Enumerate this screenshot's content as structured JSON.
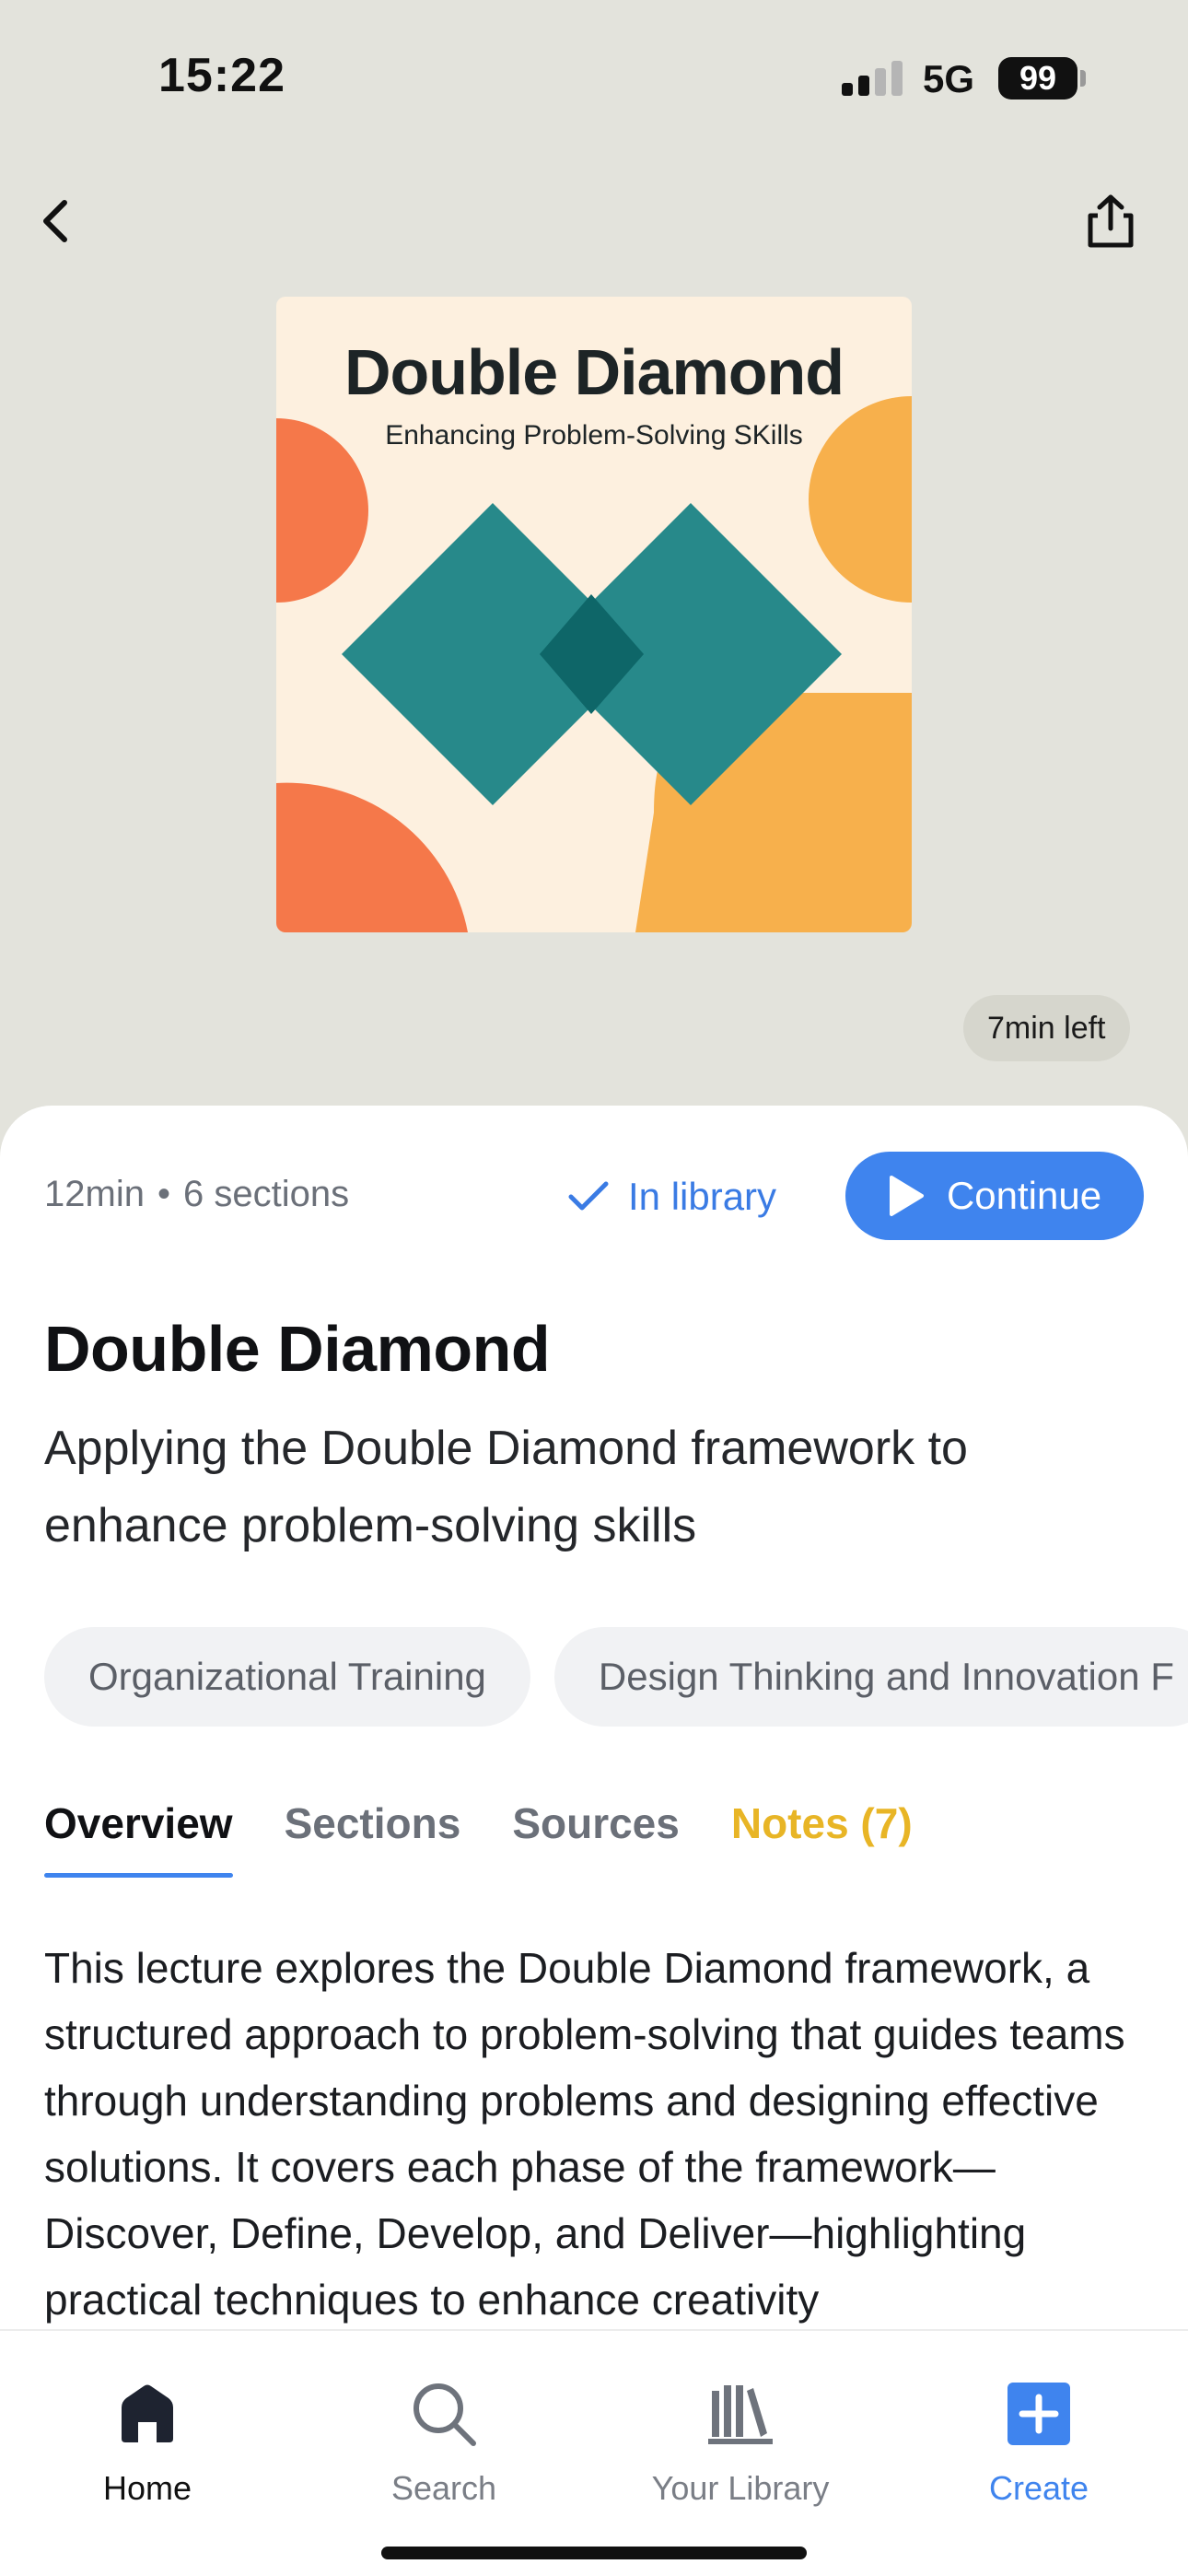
{
  "status_bar": {
    "time": "15:22",
    "network": "5G",
    "battery": "99"
  },
  "header": {
    "back_icon": "chevron-left-icon",
    "share_icon": "share-icon"
  },
  "cover": {
    "title": "Double Diamond",
    "subtitle": "Enhancing Problem-Solving SKills",
    "colors": {
      "background": "#fdf0df",
      "teal": "#27898a",
      "teal_dark": "#0e6668",
      "orange": "#f5784a",
      "yellow": "#f7b04c"
    }
  },
  "progress": {
    "time_left": "7min left"
  },
  "details": {
    "duration": "12min",
    "separator": "•",
    "sections_count": "6 sections",
    "library_status": "In library",
    "continue_label": "Continue",
    "title": "Double Diamond",
    "subtitle": "Applying the Double Diamond framework to enhance problem-solving skills",
    "tags": [
      "Organizational Training",
      "Design Thinking and Innovation F"
    ]
  },
  "tabs": [
    {
      "label": "Overview",
      "active": true
    },
    {
      "label": "Sections",
      "active": false
    },
    {
      "label": "Sources",
      "active": false
    },
    {
      "label": "Notes (7)",
      "active": false
    }
  ],
  "overview_text": "This lecture explores the Double Diamond framework, a structured approach to problem-solving that guides teams through understanding problems and designing effective solutions. It covers each phase of the framework—Discover, Define, Develop, and Deliver—highlighting practical techniques to enhance creativity",
  "tab_bar": {
    "items": [
      {
        "label": "Home",
        "icon": "home-icon"
      },
      {
        "label": "Search",
        "icon": "search-icon"
      },
      {
        "label": "Your Library",
        "icon": "library-icon"
      },
      {
        "label": "Create",
        "icon": "plus-square-icon"
      }
    ]
  },
  "colors": {
    "accent": "#3f84ee",
    "notes": "#e8b526"
  }
}
